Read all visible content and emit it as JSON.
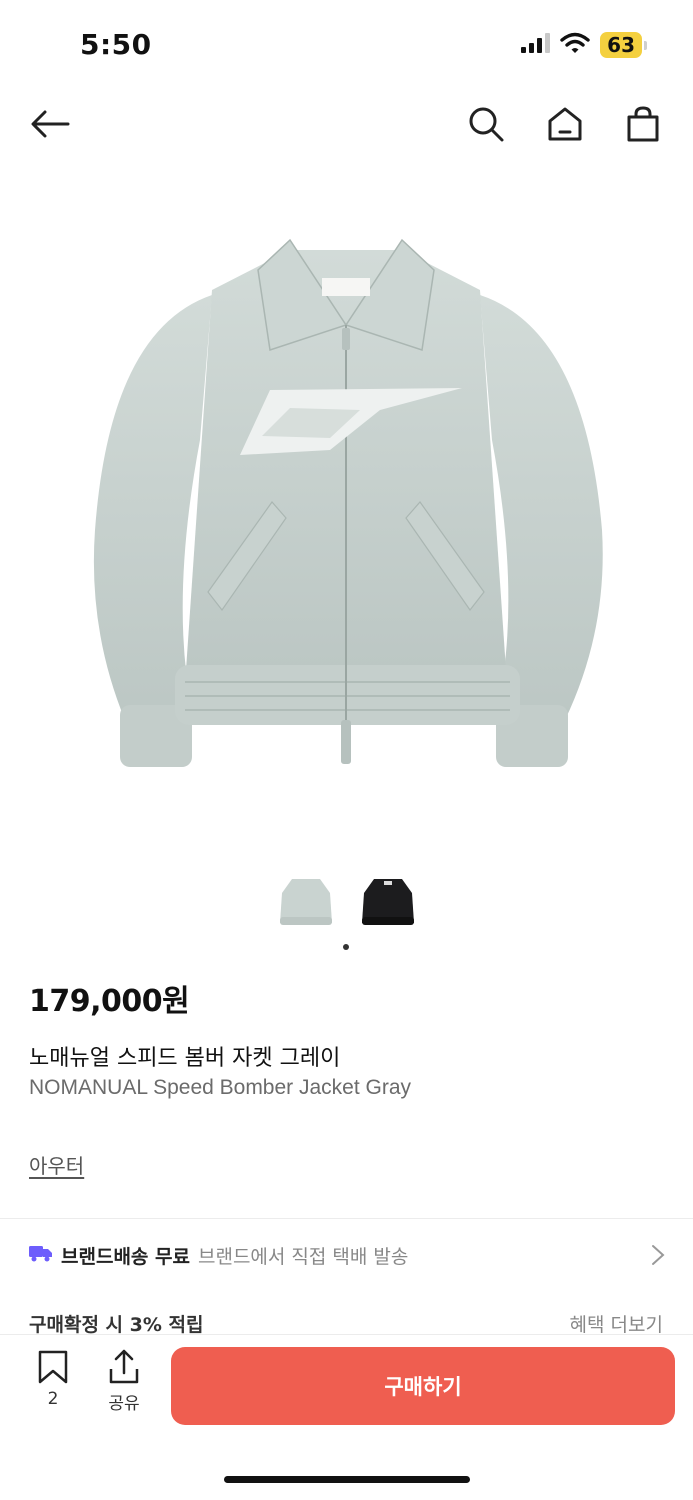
{
  "status_bar": {
    "time": "5:50",
    "battery": "63",
    "icons": [
      "signal-icon",
      "wifi-icon",
      "battery-icon"
    ]
  },
  "nav": {
    "icons": [
      "back-arrow-icon",
      "search-icon",
      "home-icon",
      "shopping-bag-icon"
    ]
  },
  "product": {
    "price": "179,000원",
    "name_ko": "노매뉴얼 스피드 봄버 자켓 그레이",
    "name_en": "NOMANUAL Speed Bomber Jacket Gray",
    "category": "아우터",
    "thumbnail_colors": [
      "#c9d3d0",
      "#1c1c1e"
    ],
    "selected_thumbnail": 1,
    "thumbnail_count": 2
  },
  "shipping": {
    "bold": "브랜드배송 무료",
    "desc": "브랜드에서 직접 택배 발송",
    "accent": "#6d5dfc"
  },
  "reward": {
    "text": "구매확정 시 3% 적립",
    "more": "혜택 더보기"
  },
  "bottom_bar": {
    "wishlist_count": "2",
    "share_label": "공유",
    "buy_label": "구매하기",
    "buy_color": "#ef5e50"
  }
}
